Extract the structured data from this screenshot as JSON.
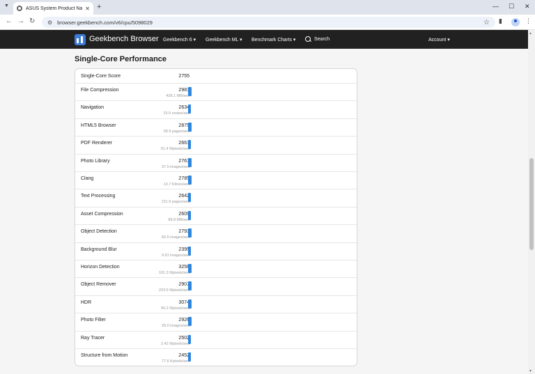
{
  "browser": {
    "tab_title": "ASUS System Product Name",
    "url": "browser.geekbench.com/v6/cpu/5098029"
  },
  "site": {
    "brand": "Geekbench Browser",
    "nav": [
      "Geekbench 6 ▾",
      "Geekbench ML ▾",
      "Benchmark Charts ▾"
    ],
    "search_label": "Search",
    "account_label": "Account ▾"
  },
  "page": {
    "heading": "Single-Core Performance",
    "score_label": "Single-Core Score",
    "score_value": "2755"
  },
  "colors": {
    "bar": "#2e86de",
    "header": "#212121"
  },
  "chart_data": {
    "type": "bar",
    "categories": [
      "File Compression",
      "Navigation",
      "HTML5 Browser",
      "PDF Renderer",
      "Photo Library",
      "Clang",
      "Text Processing",
      "Asset Compression",
      "Object Detection",
      "Background Blur",
      "Horizon Detection",
      "Object Remover",
      "HDR",
      "Photo Filter",
      "Ray Tracer",
      "Structure from Motion"
    ],
    "values": [
      2981,
      2634,
      2875,
      2661,
      2767,
      2785,
      2642,
      2609,
      2793,
      2395,
      3256,
      2907,
      3074,
      2926,
      2502,
      2452
    ],
    "descriptions": [
      "428.1 MB/sec",
      "15.9 routes/sec",
      "58.9 pages/sec",
      "61.4 Mpixels/sec",
      "37.5 images/sec",
      "13.7 Klines/sec",
      "211.6 pages/sec",
      "88.8 MB/sec",
      "83.6 images/sec",
      "9.91 images/sec",
      "101.3 Mpixels/sec",
      "223.5 Mpixels/sec",
      "90.2 Mpixels/sec",
      "29.0 images/sec",
      "2.42 Mpixels/sec",
      "77.6 Kpixels/sec"
    ]
  }
}
